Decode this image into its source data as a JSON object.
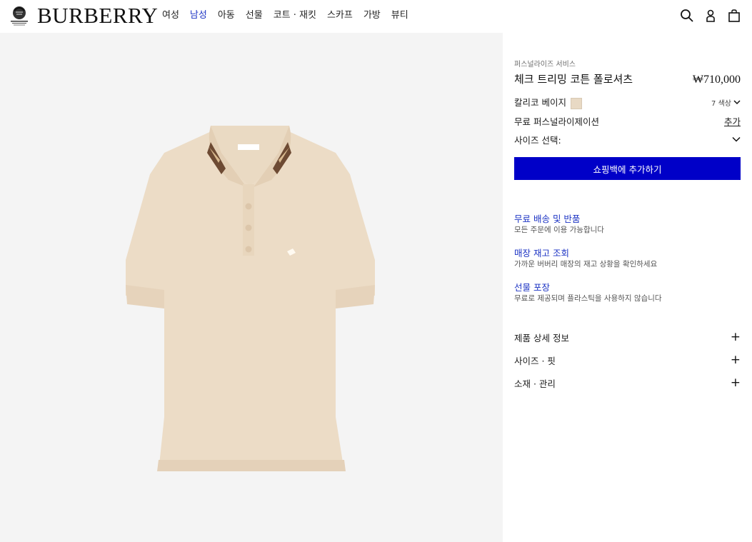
{
  "header": {
    "brand": "BURBERRY",
    "nav": [
      {
        "label": "여성",
        "active": false
      },
      {
        "label": "남성",
        "active": true
      },
      {
        "label": "아동",
        "active": false
      },
      {
        "label": "선물",
        "active": false
      },
      {
        "label": "코트 · 재킷",
        "active": false
      },
      {
        "label": "스카프",
        "active": false
      },
      {
        "label": "가방",
        "active": false
      },
      {
        "label": "뷰티",
        "active": false
      }
    ],
    "icons": [
      "search-icon",
      "account-icon",
      "shopping-bag-icon"
    ]
  },
  "product": {
    "eyebrow": "퍼스널라이즈 서비스",
    "title": "체크 트리밍 코튼 폴로셔츠",
    "price": "₩710,000",
    "color_name": "칼리코 베이지",
    "color_hex": "#e8d9c4",
    "colors_count": "7 색상",
    "personalization_label": "무료 퍼스널라이제이션",
    "personalization_action": "추가",
    "size_label": "사이즈 선택:",
    "add_to_bag": "쇼핑백에 추가하기"
  },
  "services": [
    {
      "title": "무료 배송 및 반품",
      "desc": "모든 주문에 이용 가능합니다"
    },
    {
      "title": "매장 재고 조회",
      "desc": "가까운 버버리 매장의 재고 상황을 확인하세요"
    },
    {
      "title": "선물 포장",
      "desc": "무료로 제공되며 플라스틱을 사용하지 않습니다"
    }
  ],
  "accordions": [
    {
      "label": "제품 상세 정보"
    },
    {
      "label": "사이즈 · 핏"
    },
    {
      "label": "소재 · 관리"
    }
  ],
  "colors": {
    "accent": "#0000c8",
    "link": "#1d34c4",
    "gallery_bg": "#f4f4f4",
    "shirt": "#ecdcc6"
  }
}
